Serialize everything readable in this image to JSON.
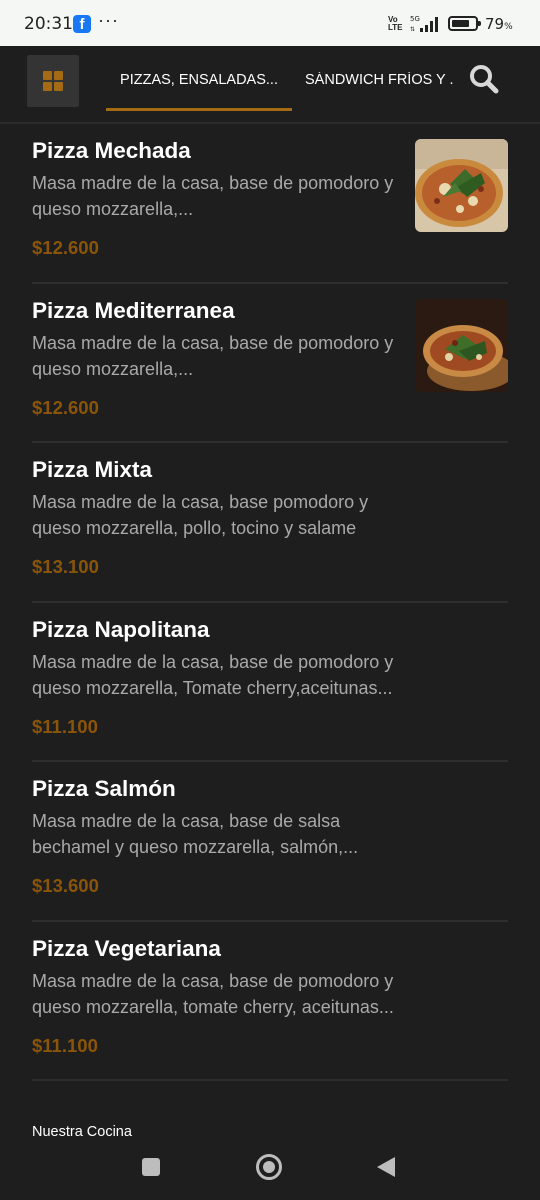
{
  "status_bar": {
    "time": "20:31",
    "more": "···",
    "network_top": "Vo",
    "network_bottom": "LTE",
    "signal_label": "5G",
    "battery_level": 0.79,
    "battery_percent": "79",
    "battery_unit": "%"
  },
  "header": {
    "menu_icon": "grid-icon",
    "tabs": [
      {
        "label": "PIZZAS, ENSALADAS...",
        "active": true
      },
      {
        "label": "SÁNDWICH FRÍOS Y ..",
        "active": false
      }
    ],
    "search_icon": "search-icon",
    "accent_color": "#a46a14"
  },
  "menu_items": [
    {
      "name": "Pizza Mechada",
      "description": "Masa madre de la casa, base de pomodoro y queso mozzarella,...",
      "price": "$12.600",
      "has_photo": true
    },
    {
      "name": "Pizza Mediterranea",
      "description": "Masa madre de la casa, base de pomodoro y queso mozzarella,...",
      "price": "$12.600",
      "has_photo": true
    },
    {
      "name": "Pizza Mixta",
      "description": "Masa madre de la casa, base pomodoro y queso mozzarella, pollo, tocino y salame",
      "price": "$13.100",
      "has_photo": false
    },
    {
      "name": "Pizza Napolitana",
      "description": "Masa madre de la casa, base de pomodoro y queso mozzarella, Tomate cherry,aceitunas...",
      "price": "$11.100",
      "has_photo": false
    },
    {
      "name": "Pizza Salmón",
      "description": "Masa madre de la casa, base de salsa bechamel y queso mozzarella, salmón,...",
      "price": "$13.600",
      "has_photo": false
    },
    {
      "name": "Pizza Vegetariana",
      "description": "Masa madre de la casa, base de pomodoro y queso mozzarella, tomate cherry, aceitunas...",
      "price": "$11.100",
      "has_photo": false
    }
  ],
  "footer": {
    "link": "Nuestra Cocina"
  },
  "colors": {
    "background": "#1e1e1e",
    "price": "#8a5509",
    "description": "#a9a9a9"
  }
}
